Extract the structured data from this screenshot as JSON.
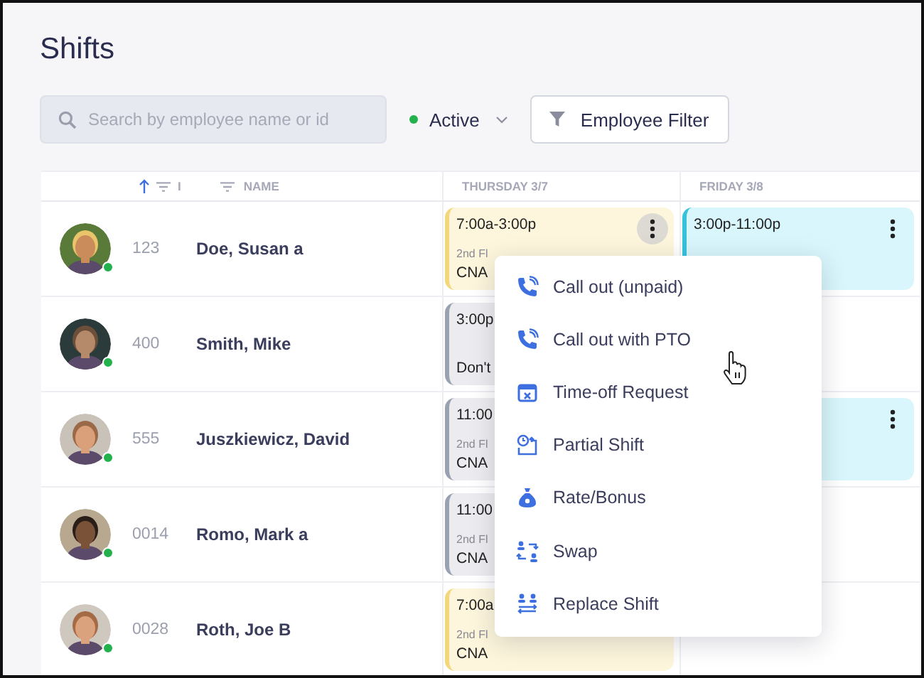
{
  "title": "Shifts",
  "search": {
    "placeholder": "Search by employee name or id"
  },
  "status_filter": {
    "label": "Active",
    "color": "#22b14c"
  },
  "filter_button": {
    "label": "Employee Filter"
  },
  "columns": [
    {
      "kind": "sort",
      "label": "I"
    },
    {
      "kind": "filter",
      "label": "NAME"
    },
    {
      "kind": "day",
      "label": "THURSDAY 3/7"
    },
    {
      "kind": "day",
      "label": "FRIDAY 3/8"
    }
  ],
  "rows": [
    {
      "id": "123",
      "name": "Doe, Susan a",
      "online": true,
      "thursday": {
        "time": "7:00a-3:00p",
        "location": "2nd Fl",
        "role": "CNA",
        "color": "#fdf6dc",
        "menu_open": true
      },
      "friday": {
        "time": "3:00p-11:00p",
        "color": "#d8f6fb",
        "menu_open": false
      }
    },
    {
      "id": "400",
      "name": "Smith, Mike",
      "online": true,
      "thursday": {
        "time": "3:00p",
        "role": "Don't",
        "color": "#ececf0"
      }
    },
    {
      "id": "555",
      "name": "Juszkiewicz, David",
      "online": true,
      "thursday": {
        "time": "11:00",
        "location": "2nd Fl",
        "role": "CNA",
        "color": "#ececf0"
      },
      "friday": {
        "color": "#d8f6fb",
        "menu_open": false
      }
    },
    {
      "id": "0014",
      "name": "Romo, Mark a",
      "online": true,
      "thursday": {
        "time": "11:00",
        "location": "2nd Fl",
        "role": "CNA",
        "color": "#ececf0"
      }
    },
    {
      "id": "0028",
      "name": "Roth, Joe B",
      "online": true,
      "thursday": {
        "time": "7:00a",
        "location": "2nd Fl",
        "role": "CNA",
        "color": "#fdf6dc"
      }
    }
  ],
  "menu": {
    "items": [
      {
        "label": "Call out (unpaid)",
        "kind": "call"
      },
      {
        "label": "Call out with PTO",
        "kind": "call"
      },
      {
        "label": "Time-off Request",
        "kind": "timeoff"
      },
      {
        "label": "Partial Shift",
        "kind": "partial"
      },
      {
        "label": "Rate/Bonus",
        "kind": "rate"
      },
      {
        "label": "Swap",
        "kind": "swap"
      },
      {
        "label": "Replace Shift",
        "kind": "replace"
      }
    ]
  }
}
